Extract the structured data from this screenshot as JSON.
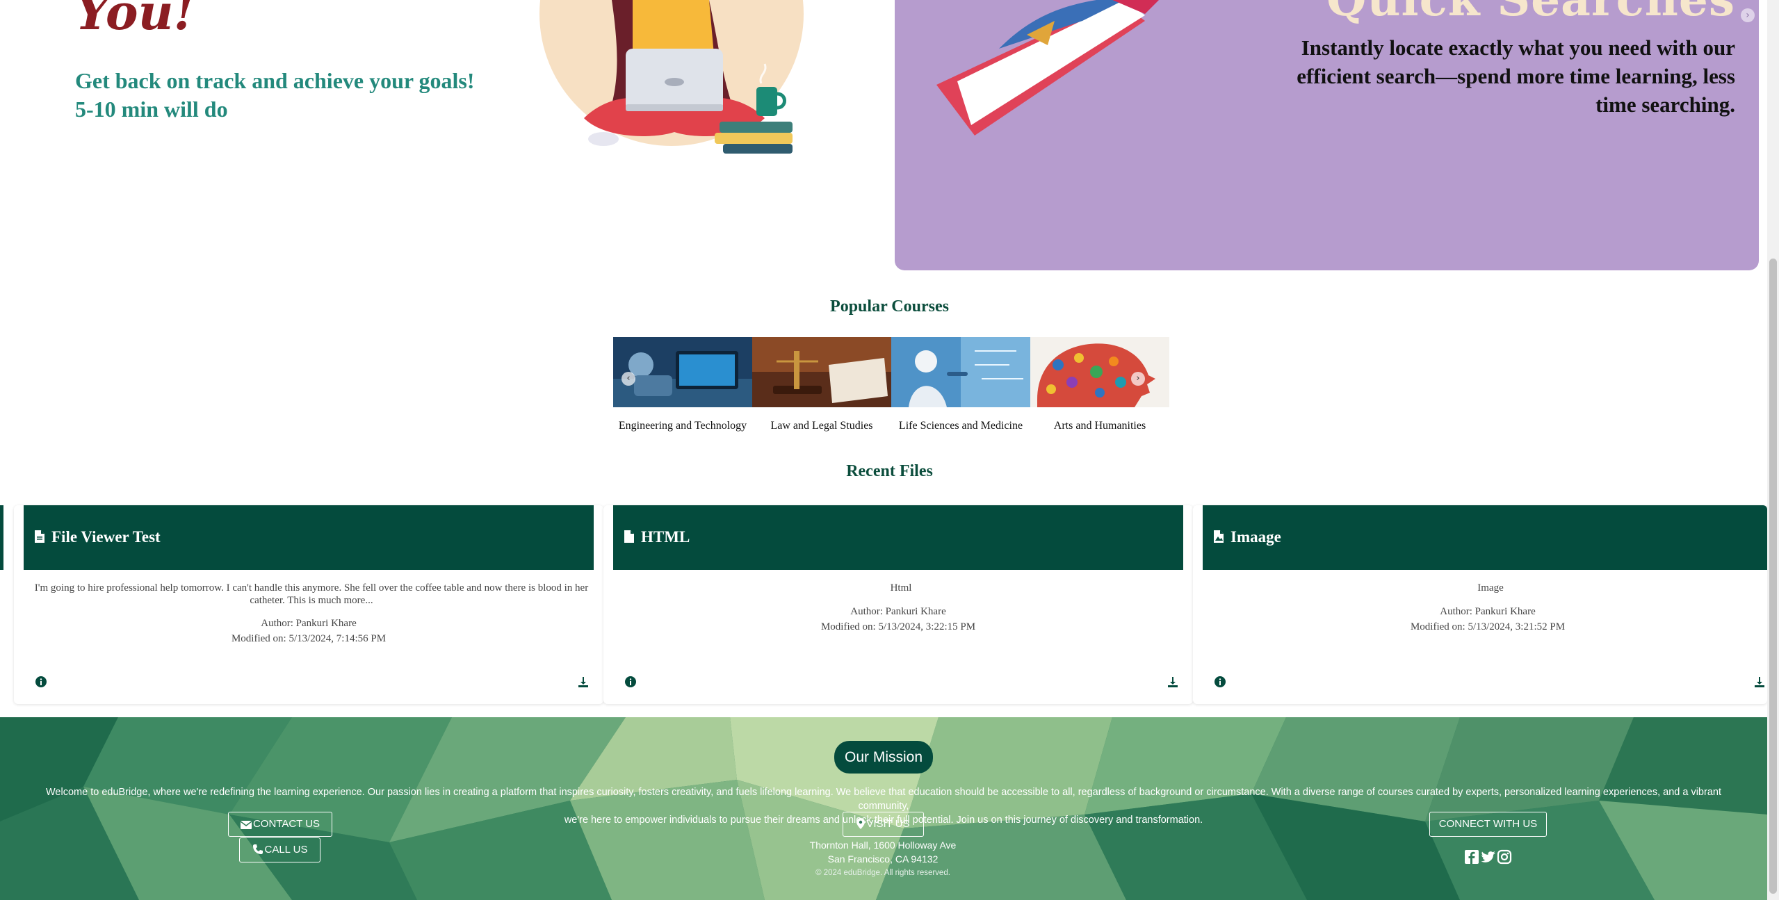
{
  "hero": {
    "heading": "You!",
    "subtitle_line1": "Get back on track and achieve your goals!",
    "subtitle_line2": "5-10 min will do"
  },
  "slide": {
    "heading": "Quick Searches",
    "text": "Instantly locate exactly what you need with our efficient search—spend more time learning, less time searching.",
    "next_icon": "chevron-right-icon"
  },
  "popular_courses": {
    "title": "Popular Courses",
    "items": [
      {
        "label": "Engineering and Technology"
      },
      {
        "label": "Law and Legal Studies"
      },
      {
        "label": "Life Sciences and Medicine"
      },
      {
        "label": "Arts and Humanities"
      }
    ]
  },
  "recent_files": {
    "title": "Recent Files",
    "cards": [
      {
        "title": "File Viewer Test",
        "description": "I'm going to hire professional help tomorrow. I can't handle this anymore. She fell over the coffee table and now there is blood in her catheter. This is much more...",
        "author": "Author: Pankuri Khare",
        "modified": "Modified on: 5/13/2024, 7:14:56 PM"
      },
      {
        "title": "HTML",
        "description": "Html",
        "author": "Author: Pankuri Khare",
        "modified": "Modified on: 5/13/2024, 3:22:15 PM"
      },
      {
        "title": "Imaage",
        "description": "Image",
        "author": "Author: Pankuri Khare",
        "modified": "Modified on: 5/13/2024, 3:21:52 PM"
      }
    ]
  },
  "footer": {
    "mission_button": "Our Mission",
    "mission_text_line1": "Welcome to eduBridge, where we're redefining the learning experience. Our passion lies in creating a platform that inspires curiosity, fosters creativity, and fuels lifelong learning. We believe that education should be accessible to all, regardless of background or circumstance. With a diverse range of courses curated by experts, personalized learning experiences, and a vibrant community,",
    "mission_text_line2": "we're here to empower individuals to pursue their dreams and unlock their full potential. Join us on this journey of discovery and transformation.",
    "contact_us": "CONTACT US",
    "call_us": "CALL US",
    "visit_us": "VISIT US",
    "address_line1": "Thornton Hall, 1600 Holloway Ave",
    "address_line2": "San Francisco, CA 94132",
    "copyright": "© 2024 eduBridge. All rights reserved.",
    "connect_with_us": "CONNECT WITH US",
    "social_icons": [
      "facebook-icon",
      "twitter-icon",
      "instagram-icon"
    ]
  },
  "colors": {
    "brand_dark_green": "#044b3d",
    "heading_green": "#0b4d3c",
    "teal_text": "#23897c",
    "hero_red": "#8b1d22",
    "slide_purple": "#b69cce"
  }
}
